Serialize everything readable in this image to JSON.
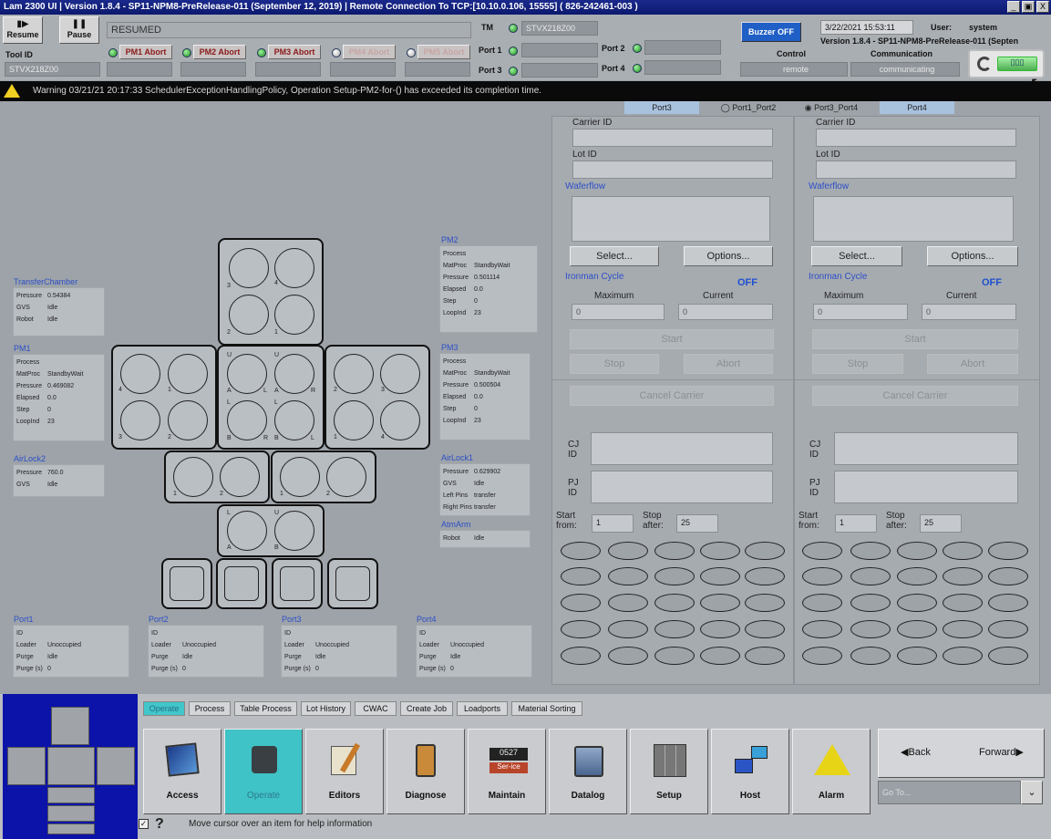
{
  "window": {
    "title": "Lam 2300 UI  |  Version 1.8.4 - SP11-NPM8-PreRelease-011 (September 12, 2019)  |  Remote Connection To TCP:[10.10.0.106, 15555] ( 826-242461-003 )",
    "min": "_",
    "max": "▣",
    "close": "X"
  },
  "toolbar": {
    "resume": "Resume",
    "pause": "Pause",
    "state": "RESUMED",
    "tool_id_label": "Tool ID",
    "tool_id_value": "STVX218Z00",
    "abort_buttons": [
      "PM1 Abort",
      "PM2 Abort",
      "PM3 Abort",
      "PM4 Abort",
      "PM5 Abort"
    ],
    "tm_label": "TM",
    "tm_value": "STVX218Z00",
    "port1": "Port 1",
    "port2": "Port 2",
    "port3": "Port 3",
    "port4": "Port 4",
    "buzzer": "Buzzer OFF",
    "date": "3/22/2021  15:53:11",
    "user_label": "User:",
    "user_value": "system",
    "version": "Version 1.8.4 - SP11-NPM8-PreRelease-011 (Septen",
    "control_label": "Control",
    "control_value": "remote",
    "comm_label": "Communication",
    "comm_value": "communicating"
  },
  "warning": {
    "text": "Warning 03/21/21 20:17:33 SchedulerExceptionHandlingPolicy, Operation Setup-PM2-for-() has exceeded its completion time."
  },
  "status": {
    "transfer_chamber": {
      "title": "TransferChamber",
      "rows": [
        [
          "Pressure",
          "0.54384"
        ],
        [
          "GVS",
          "Idle"
        ],
        [
          "Robot",
          "Idle"
        ]
      ]
    },
    "pm1": {
      "title": "PM1",
      "rows": [
        [
          "Process",
          ""
        ],
        [
          "MatProc",
          "StandbyWait"
        ],
        [
          "Pressure",
          "0.469082"
        ],
        [
          "Elapsed",
          "0.0"
        ],
        [
          "Step",
          "0"
        ],
        [
          "LoopInd",
          "23"
        ]
      ]
    },
    "airlock2": {
      "title": "AirLock2",
      "rows": [
        [
          "Pressure",
          "760.0"
        ],
        [
          "GVS",
          "Idle"
        ]
      ]
    },
    "pm2": {
      "title": "PM2",
      "rows": [
        [
          "Process",
          ""
        ],
        [
          "MatProc",
          "StandbyWait"
        ],
        [
          "Pressure",
          "0.501114"
        ],
        [
          "Elapsed",
          "0.0"
        ],
        [
          "Step",
          "0"
        ],
        [
          "LoopInd",
          "23"
        ]
      ]
    },
    "pm3": {
      "title": "PM3",
      "rows": [
        [
          "Process",
          ""
        ],
        [
          "MatProc",
          "StandbyWait"
        ],
        [
          "Pressure",
          "0.500504"
        ],
        [
          "Elapsed",
          "0.0"
        ],
        [
          "Step",
          "0"
        ],
        [
          "LoopInd",
          "23"
        ]
      ]
    },
    "airlock1": {
      "title": "AirLock1",
      "rows": [
        [
          "Pressure",
          "0.629902"
        ],
        [
          "GVS",
          "Idle"
        ],
        [
          "Left Pins",
          "transfer"
        ],
        [
          "Right Pins",
          "transfer"
        ]
      ]
    },
    "atmarm": {
      "title": "AtmArm",
      "rows": [
        [
          "Robot",
          "Idle"
        ]
      ]
    },
    "ports": [
      {
        "title": "Port1",
        "rows": [
          [
            "ID",
            ""
          ],
          [
            "Loader",
            "Unoccupied"
          ],
          [
            "Purge",
            "Idle"
          ],
          [
            "Purge (s)",
            "0"
          ]
        ]
      },
      {
        "title": "Port2",
        "rows": [
          [
            "ID",
            ""
          ],
          [
            "Loader",
            "Unoccupied"
          ],
          [
            "Purge",
            "Idle"
          ],
          [
            "Purge (s)",
            "0"
          ]
        ]
      },
      {
        "title": "Port3",
        "rows": [
          [
            "ID",
            ""
          ],
          [
            "Loader",
            "Unoccupied"
          ],
          [
            "Purge",
            "Idle"
          ],
          [
            "Purge (s)",
            "0"
          ]
        ]
      },
      {
        "title": "Port4",
        "rows": [
          [
            "ID",
            ""
          ],
          [
            "Loader",
            "Unoccupied"
          ],
          [
            "Purge",
            "Idle"
          ],
          [
            "Purge (s)",
            "0"
          ]
        ]
      }
    ]
  },
  "diagram_labels": {
    "pm2": [
      "3",
      "4",
      "2",
      "1"
    ],
    "pm1": [
      "4",
      "1",
      "3",
      "2"
    ],
    "tm": [
      "U",
      "U",
      "A",
      "L",
      "A",
      "R",
      "L",
      "L",
      "B",
      "R",
      "B",
      "L"
    ],
    "pm3": [
      "2",
      "3",
      "1",
      "4"
    ],
    "al2": [
      "1",
      "2"
    ],
    "al1": [
      "1",
      "2"
    ],
    "atm": [
      "L",
      "U",
      "A",
      "B"
    ]
  },
  "right_tabs": [
    "Port3",
    "Port1_Port2",
    "Port3_Port4",
    "Port4"
  ],
  "carrier_panels": [
    {
      "carrier_id": "Carrier ID",
      "lot_id": "Lot ID",
      "waferflow": "Waferflow",
      "select": "Select...",
      "options": "Options...",
      "ironman": "Ironman Cycle",
      "ironman_state": "OFF",
      "maximum": "Maximum",
      "current": "Current",
      "max_val": "0",
      "cur_val": "0",
      "start": "Start",
      "stop": "Stop",
      "abort": "Abort",
      "cancel": "Cancel Carrier",
      "cj": "CJ ID",
      "pj": "PJ ID",
      "start_from_label": "Start from:",
      "start_from": "1",
      "stop_after_label": "Stop after:",
      "stop_after": "25"
    },
    {
      "carrier_id": "Carrier ID",
      "lot_id": "Lot ID",
      "waferflow": "Waferflow",
      "select": "Select...",
      "options": "Options...",
      "ironman": "Ironman Cycle",
      "ironman_state": "OFF",
      "maximum": "Maximum",
      "current": "Current",
      "max_val": "0",
      "cur_val": "0",
      "start": "Start",
      "stop": "Stop",
      "abort": "Abort",
      "cancel": "Cancel Carrier",
      "cj": "CJ ID",
      "pj": "PJ ID",
      "start_from_label": "Start from:",
      "start_from": "1",
      "stop_after_label": "Stop after:",
      "stop_after": "25"
    }
  ],
  "bottom_tabs": [
    "Operate",
    "Process",
    "Table Process",
    "Lot History",
    "CWAC",
    "Create Job",
    "Loadports",
    "Material Sorting"
  ],
  "nav_buttons": [
    "Access",
    "Operate",
    "Editors",
    "Diagnose",
    "Maintain",
    "Datalog",
    "Setup",
    "Host",
    "Alarm"
  ],
  "history": {
    "back": "Back",
    "forward": "Forward",
    "goto_placeholder": "Go To..."
  },
  "statusbar": {
    "help": "Move cursor over an item for help information"
  }
}
